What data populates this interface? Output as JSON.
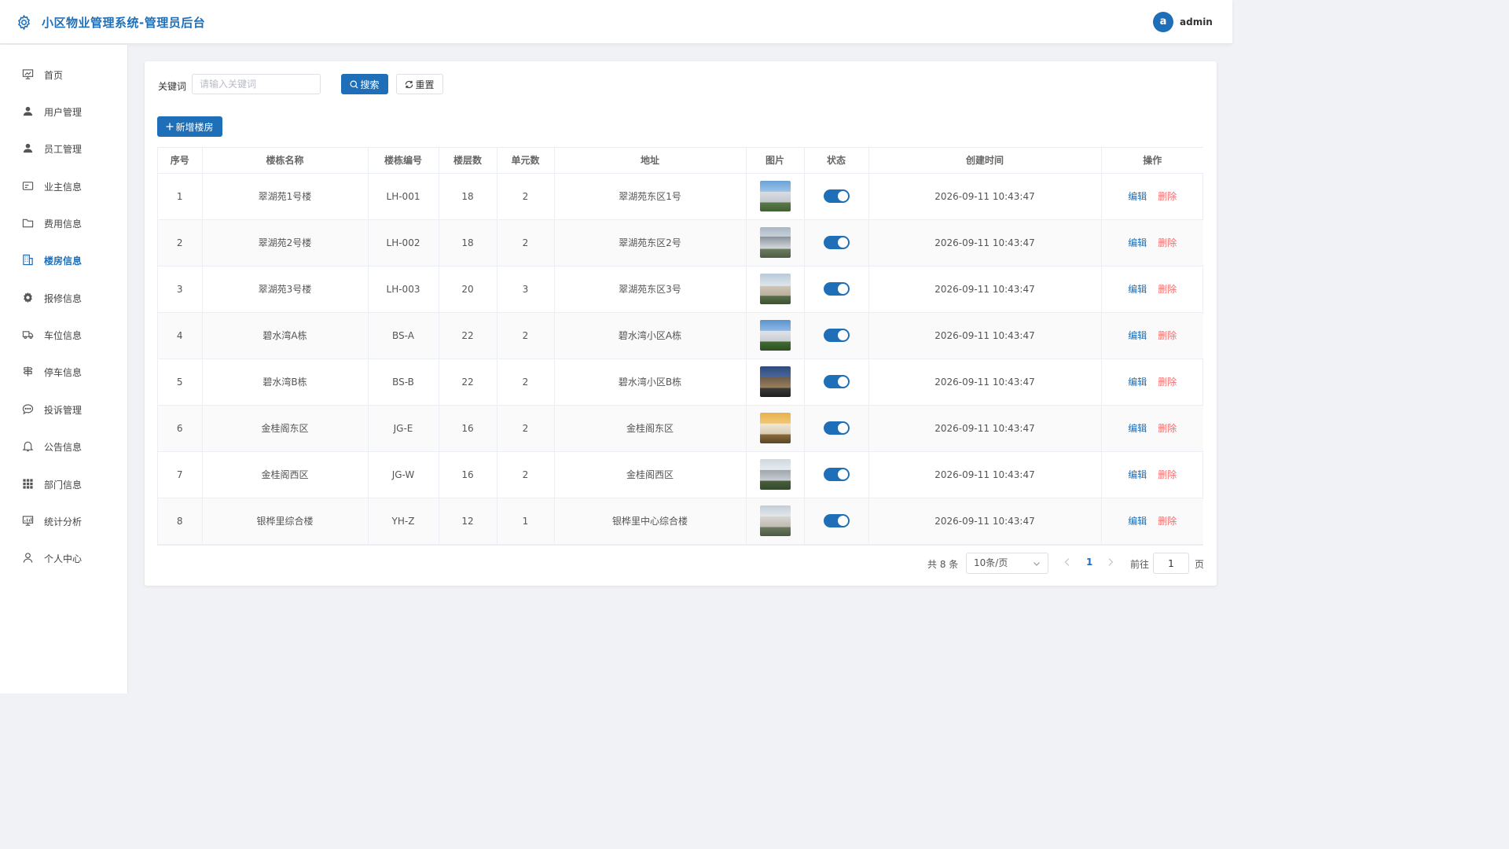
{
  "header": {
    "title": "小区物业管理系统-管理员后台",
    "avatar_letter": "a",
    "username": "admin"
  },
  "colors": {
    "primary": "#1e6fb8",
    "danger": "#f56c6c",
    "background": "#f0f2f5"
  },
  "sidebar": {
    "items": [
      {
        "label": "首页",
        "icon": "dashboard-icon",
        "active": false
      },
      {
        "label": "用户管理",
        "icon": "user-icon",
        "active": false
      },
      {
        "label": "员工管理",
        "icon": "user-icon",
        "active": false
      },
      {
        "label": "业主信息",
        "icon": "id-card-icon",
        "active": false
      },
      {
        "label": "费用信息",
        "icon": "folder-icon",
        "active": false
      },
      {
        "label": "楼房信息",
        "icon": "building-icon",
        "active": true
      },
      {
        "label": "报修信息",
        "icon": "gear-icon",
        "active": false
      },
      {
        "label": "车位信息",
        "icon": "truck-icon",
        "active": false
      },
      {
        "label": "停车信息",
        "icon": "signpost-icon",
        "active": false
      },
      {
        "label": "投诉管理",
        "icon": "chat-icon",
        "active": false
      },
      {
        "label": "公告信息",
        "icon": "bell-icon",
        "active": false
      },
      {
        "label": "部门信息",
        "icon": "grid-icon",
        "active": false
      },
      {
        "label": "统计分析",
        "icon": "chart-icon",
        "active": false
      },
      {
        "label": "个人中心",
        "icon": "person-icon",
        "active": false
      }
    ]
  },
  "search": {
    "label": "关键词",
    "placeholder": "请输入关键词",
    "value": "",
    "search_button": "搜索",
    "reset_button": "重置"
  },
  "toolbar": {
    "add_button": "新增楼房"
  },
  "table": {
    "columns": [
      "序号",
      "楼栋名称",
      "楼栋编号",
      "楼层数",
      "单元数",
      "地址",
      "图片",
      "状态",
      "创建时间",
      "操作"
    ],
    "rows": [
      {
        "idx": "1",
        "name": "翠湖苑1号楼",
        "code": "LH-001",
        "floors": "18",
        "units": "2",
        "address": "翠湖苑东区1号",
        "status": "on",
        "created": "2026-09-11 10:43:47"
      },
      {
        "idx": "2",
        "name": "翠湖苑2号楼",
        "code": "LH-002",
        "floors": "18",
        "units": "2",
        "address": "翠湖苑东区2号",
        "status": "on",
        "created": "2026-09-11 10:43:47"
      },
      {
        "idx": "3",
        "name": "翠湖苑3号楼",
        "code": "LH-003",
        "floors": "20",
        "units": "3",
        "address": "翠湖苑东区3号",
        "status": "on",
        "created": "2026-09-11 10:43:47"
      },
      {
        "idx": "4",
        "name": "碧水湾A栋",
        "code": "BS-A",
        "floors": "22",
        "units": "2",
        "address": "碧水湾小区A栋",
        "status": "on",
        "created": "2026-09-11 10:43:47"
      },
      {
        "idx": "5",
        "name": "碧水湾B栋",
        "code": "BS-B",
        "floors": "22",
        "units": "2",
        "address": "碧水湾小区B栋",
        "status": "on",
        "created": "2026-09-11 10:43:47"
      },
      {
        "idx": "6",
        "name": "金桂阁东区",
        "code": "JG-E",
        "floors": "16",
        "units": "2",
        "address": "金桂阁东区",
        "status": "on",
        "created": "2026-09-11 10:43:47"
      },
      {
        "idx": "7",
        "name": "金桂阁西区",
        "code": "JG-W",
        "floors": "16",
        "units": "2",
        "address": "金桂阁西区",
        "status": "on",
        "created": "2026-09-11 10:43:47"
      },
      {
        "idx": "8",
        "name": "银桦里综合楼",
        "code": "YH-Z",
        "floors": "12",
        "units": "1",
        "address": "银桦里中心综合楼",
        "status": "on",
        "created": "2026-09-11 10:43:47"
      }
    ],
    "actions": {
      "edit": "编辑",
      "delete": "删除"
    }
  },
  "pagination": {
    "total_text": "共 8 条",
    "page_size": "10条/页",
    "current_page": "1",
    "goto_label": "前往",
    "goto_value": "1",
    "unit": "页"
  }
}
